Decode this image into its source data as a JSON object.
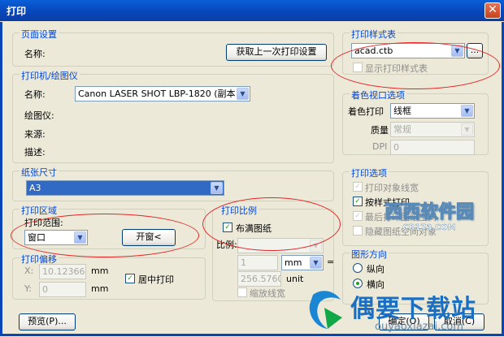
{
  "window": {
    "title": "打印",
    "close_glyph": "✕"
  },
  "page_setup": {
    "legend": "页面设置",
    "name_label": "名称:",
    "prev_button": "获取上一次打印设置"
  },
  "printer": {
    "legend": "打印机/绘图仪",
    "name_label": "名称:",
    "name_value": "Canon LASER SHOT LBP-1820 (副本 1)",
    "plotter_label": "绘图仪:",
    "where_label": "来源:",
    "desc_label": "描述:"
  },
  "paper": {
    "legend": "纸张尺寸",
    "value": "A3"
  },
  "area": {
    "legend": "打印区域",
    "range_label": "打印范围:",
    "range_value": "窗口",
    "window_button": "开窗<"
  },
  "offset": {
    "legend": "打印偏移",
    "x_label": "X:",
    "x_value": "10.123667-",
    "x_unit": "mm",
    "y_label": "Y:",
    "y_value": "0",
    "y_unit": "mm",
    "center_label": "居中打印"
  },
  "scale": {
    "legend": "打印比例",
    "fit_label": "布满图纸",
    "ratio_label": "比例:",
    "num_value": "1",
    "unit_value": "mm",
    "equals": "=",
    "den_value": "256.5760(",
    "den_unit": "unit",
    "lineweight_label": "缩放线宽"
  },
  "style_table": {
    "legend": "打印样式表",
    "value": "acad.ctb",
    "more_button": "...",
    "display_label": "显示打印样式表"
  },
  "shaded": {
    "legend": "着色视口选项",
    "shade_label": "着色打印",
    "shade_value": "线框",
    "quality_label": "质量",
    "quality_value": "常规",
    "dpi_label": "DPI",
    "dpi_value": "0"
  },
  "options": {
    "legend": "打印选项",
    "items": [
      {
        "label": "打印对象线宽",
        "checked": true,
        "enabled": false
      },
      {
        "label": "按样式打印",
        "checked": true,
        "enabled": true
      },
      {
        "label": "最后打印图纸空间",
        "checked": true,
        "enabled": false
      },
      {
        "label": "隐藏图纸空间对象",
        "checked": false,
        "enabled": false
      }
    ]
  },
  "orientation": {
    "legend": "图形方向",
    "portrait_label": "纵向",
    "landscape_label": "横向"
  },
  "footer": {
    "preview_button": "预览(P)...",
    "ok_button": "确定(O)",
    "cancel_button": "取消(C)"
  },
  "watermarks": {
    "site1": "西西软件园",
    "site1_url": "CR173.COM",
    "site2": "偶要下载站",
    "site2_url": "ouyaoxiazai.com"
  }
}
